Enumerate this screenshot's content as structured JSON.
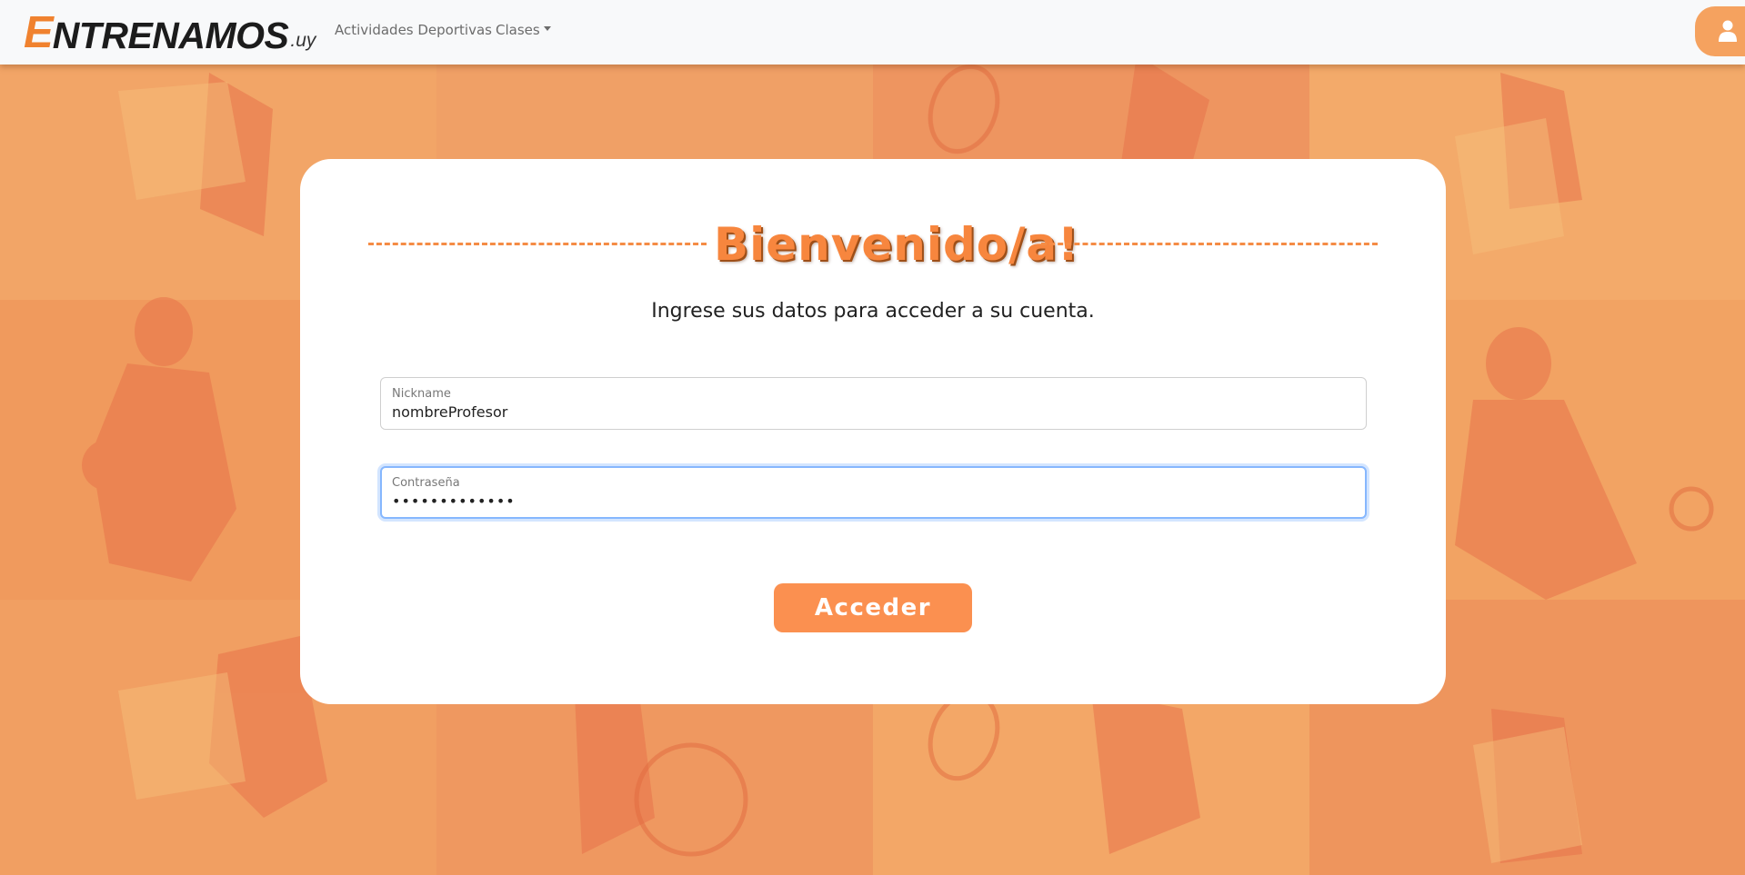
{
  "navbar": {
    "brand_initial": "E",
    "brand_rest": "NTRENAMOS",
    "brand_suffix": ".uy",
    "links": [
      {
        "label": "Actividades Deportivas"
      },
      {
        "label": "Clases"
      }
    ],
    "user_icon": "user-icon"
  },
  "login": {
    "title": "Bienvenido/a!",
    "subtitle": "Ingrese sus datos para acceder a su cuenta.",
    "nickname": {
      "label": "Nickname",
      "value": "nombreProfesor"
    },
    "password": {
      "label": "Contraseña",
      "value": "•••••••••••••"
    },
    "submit_label": "Acceder"
  },
  "colors": {
    "accent": "#f7863e",
    "navbar_bg": "#f8f9fa",
    "background": "#ef9a5e",
    "button_bg": "#fb9050"
  }
}
